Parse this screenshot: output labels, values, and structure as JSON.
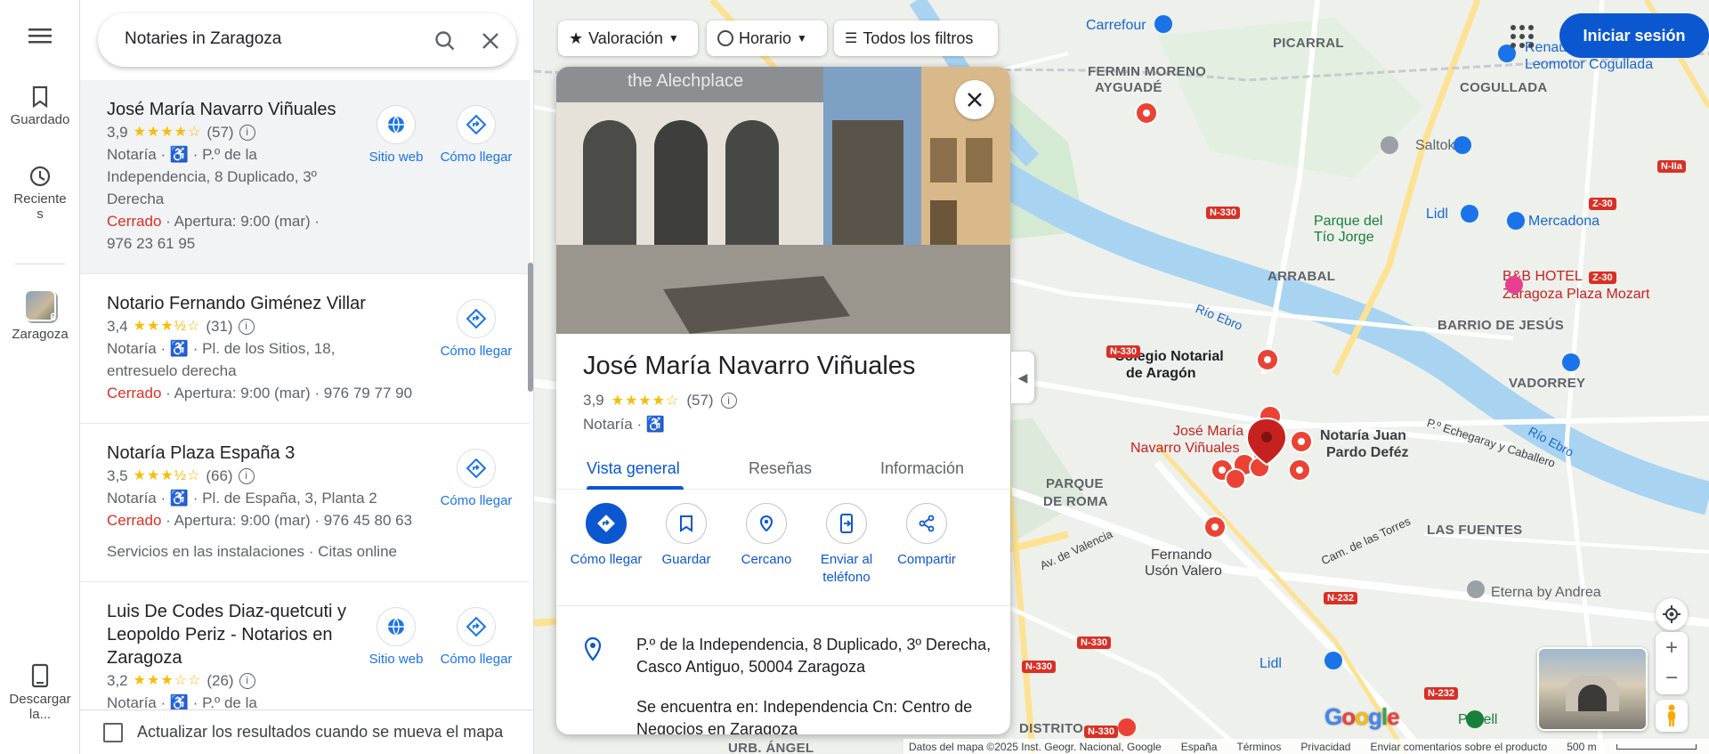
{
  "rail": {
    "menu_icon": "hamburger-icon",
    "saved": "Guardado",
    "recent_line1": "Reciente",
    "recent_line2": "s",
    "zaragoza": "Zaragoza",
    "zaragoza_badge": "6",
    "download_line1": "Descargar",
    "download_line2": "la..."
  },
  "search": {
    "value": "Notaries in Zaragoza"
  },
  "results": [
    {
      "name": "José María Navarro Viñuales",
      "rating": "3,9",
      "stars": "★★★★☆",
      "count": "(57)",
      "type": "Notaría",
      "address": "P.º de la Independencia, 8 Duplicado, 3º Derecha",
      "status": "Cerrado",
      "opening": "Apertura: 9:00 (mar)",
      "phone": "976 23 61 95",
      "website": "Sitio web",
      "directions": "Cómo llegar"
    },
    {
      "name": "Notario Fernando Giménez Villar",
      "rating": "3,4",
      "stars": "★★★½☆",
      "count": "(31)",
      "type": "Notaría",
      "address": "Pl. de los Sitios, 18, entresuelo derecha",
      "status": "Cerrado",
      "opening": "Apertura: 9:00 (mar)",
      "phone": "976 79 77 90",
      "directions": "Cómo llegar"
    },
    {
      "name": "Notaría Plaza España 3",
      "rating": "3,5",
      "stars": "★★★½☆",
      "count": "(66)",
      "type": "Notaría",
      "address": "Pl. de España, 3, Planta 2",
      "status": "Cerrado",
      "opening": "Apertura: 9:00 (mar)",
      "phone": "976 45 80 63",
      "services": "Servicios en las instalaciones · Citas online",
      "directions": "Cómo llegar"
    },
    {
      "name": "Luis De Codes Diaz-quetcuti y Leopoldo Periz - Notarios en Zaragoza",
      "rating": "3,2",
      "stars": "★★★☆☆",
      "count": "(26)",
      "type": "Notaría",
      "address": "P.º de la",
      "website": "Sitio web",
      "directions": "Cómo llegar"
    }
  ],
  "update_checkbox": "Actualizar los resultados cuando se mueva el mapa",
  "filters": {
    "rating": "Valoración",
    "hours": "Horario",
    "all": "Todos los filtros"
  },
  "signin": "Iniciar sesión",
  "card": {
    "name": "José María Navarro Viñuales",
    "rating": "3,9",
    "stars": "★★★★☆",
    "count": "(57)",
    "type": "Notaría",
    "tabs": [
      "Vista general",
      "Reseñas",
      "Información"
    ],
    "actions": {
      "directions": "Cómo llegar",
      "save": "Guardar",
      "nearby": "Cercano",
      "send_line1": "Enviar al",
      "send_line2": "teléfono",
      "share": "Compartir"
    },
    "address": "P.º de la Independencia, 8 Duplicado, 3º Derecha, Casco Antiguo, 50004 Zaragoza",
    "located_in": "Se encuentra en: Independencia Cn: Centro de Negocios en Zaragoza"
  },
  "map": {
    "labels": {
      "picarral": "PICARRAL",
      "fermin1": "FERMIN MORENO",
      "fermin2": "AYGUADÉ",
      "cogullada": "COGULLADA",
      "arrabal": "ARRABAL",
      "barrio_jesus": "BARRIO DE JESÚS",
      "vadorrey": "VADORREY",
      "parque_roma1": "PARQUE",
      "parque_roma2": "DE ROMA",
      "las_fuentes": "LAS FUENTES",
      "distrito": "DISTRITO",
      "urb_angel": "URB. ÁNGEL",
      "rio_ebro1": "Río Ebro",
      "rio_ebro2": "Río Ebro",
      "pecharay": "P.º Echegaray y Caballero",
      "av_valencia": "Av. de Valencia",
      "cam_torres": "Cam. de las Torres"
    },
    "places": {
      "carrefour": "Carrefour",
      "renault1": "Renau",
      "renault2": "Leomotor Cogullada",
      "saltoki": "Saltoki",
      "lidl1": "Lidl",
      "mercadona": "Mercadona",
      "parque_tio1": "Parque del",
      "parque_tio2": "Tío Jorge",
      "bb1": "B&B HOTEL",
      "bb2": "Zaragoza Plaza Mozart",
      "colegio1": "Colegio Notarial",
      "colegio2": "de Aragón",
      "jose1": "José María",
      "jose2": "Navarro Viñuales",
      "pardo1": "Notaría Juan",
      "pardo2": "Pardo Deféz",
      "fernando1": "Fernando",
      "fernando2": "Usón Valero",
      "lidl2": "Lidl",
      "eterna": "Eterna by Andrea",
      "pabell": "Pabell"
    },
    "roads": [
      "N-330",
      "N-330",
      "N-330",
      "N-232",
      "N-232",
      "Z-30",
      "Z-30",
      "N-IIa",
      "N-330",
      "N-330"
    ]
  },
  "footer": {
    "data": "Datos del mapa ©2025 Inst. Geogr. Nacional, Google",
    "country": "España",
    "terms": "Términos",
    "privacy": "Privacidad",
    "feedback": "Enviar comentarios sobre el producto",
    "scale": "500 m"
  },
  "colors": {
    "accent": "#0b57d0",
    "closed": "#d93025",
    "star": "#fbbc04",
    "pin": "#ea4335"
  }
}
